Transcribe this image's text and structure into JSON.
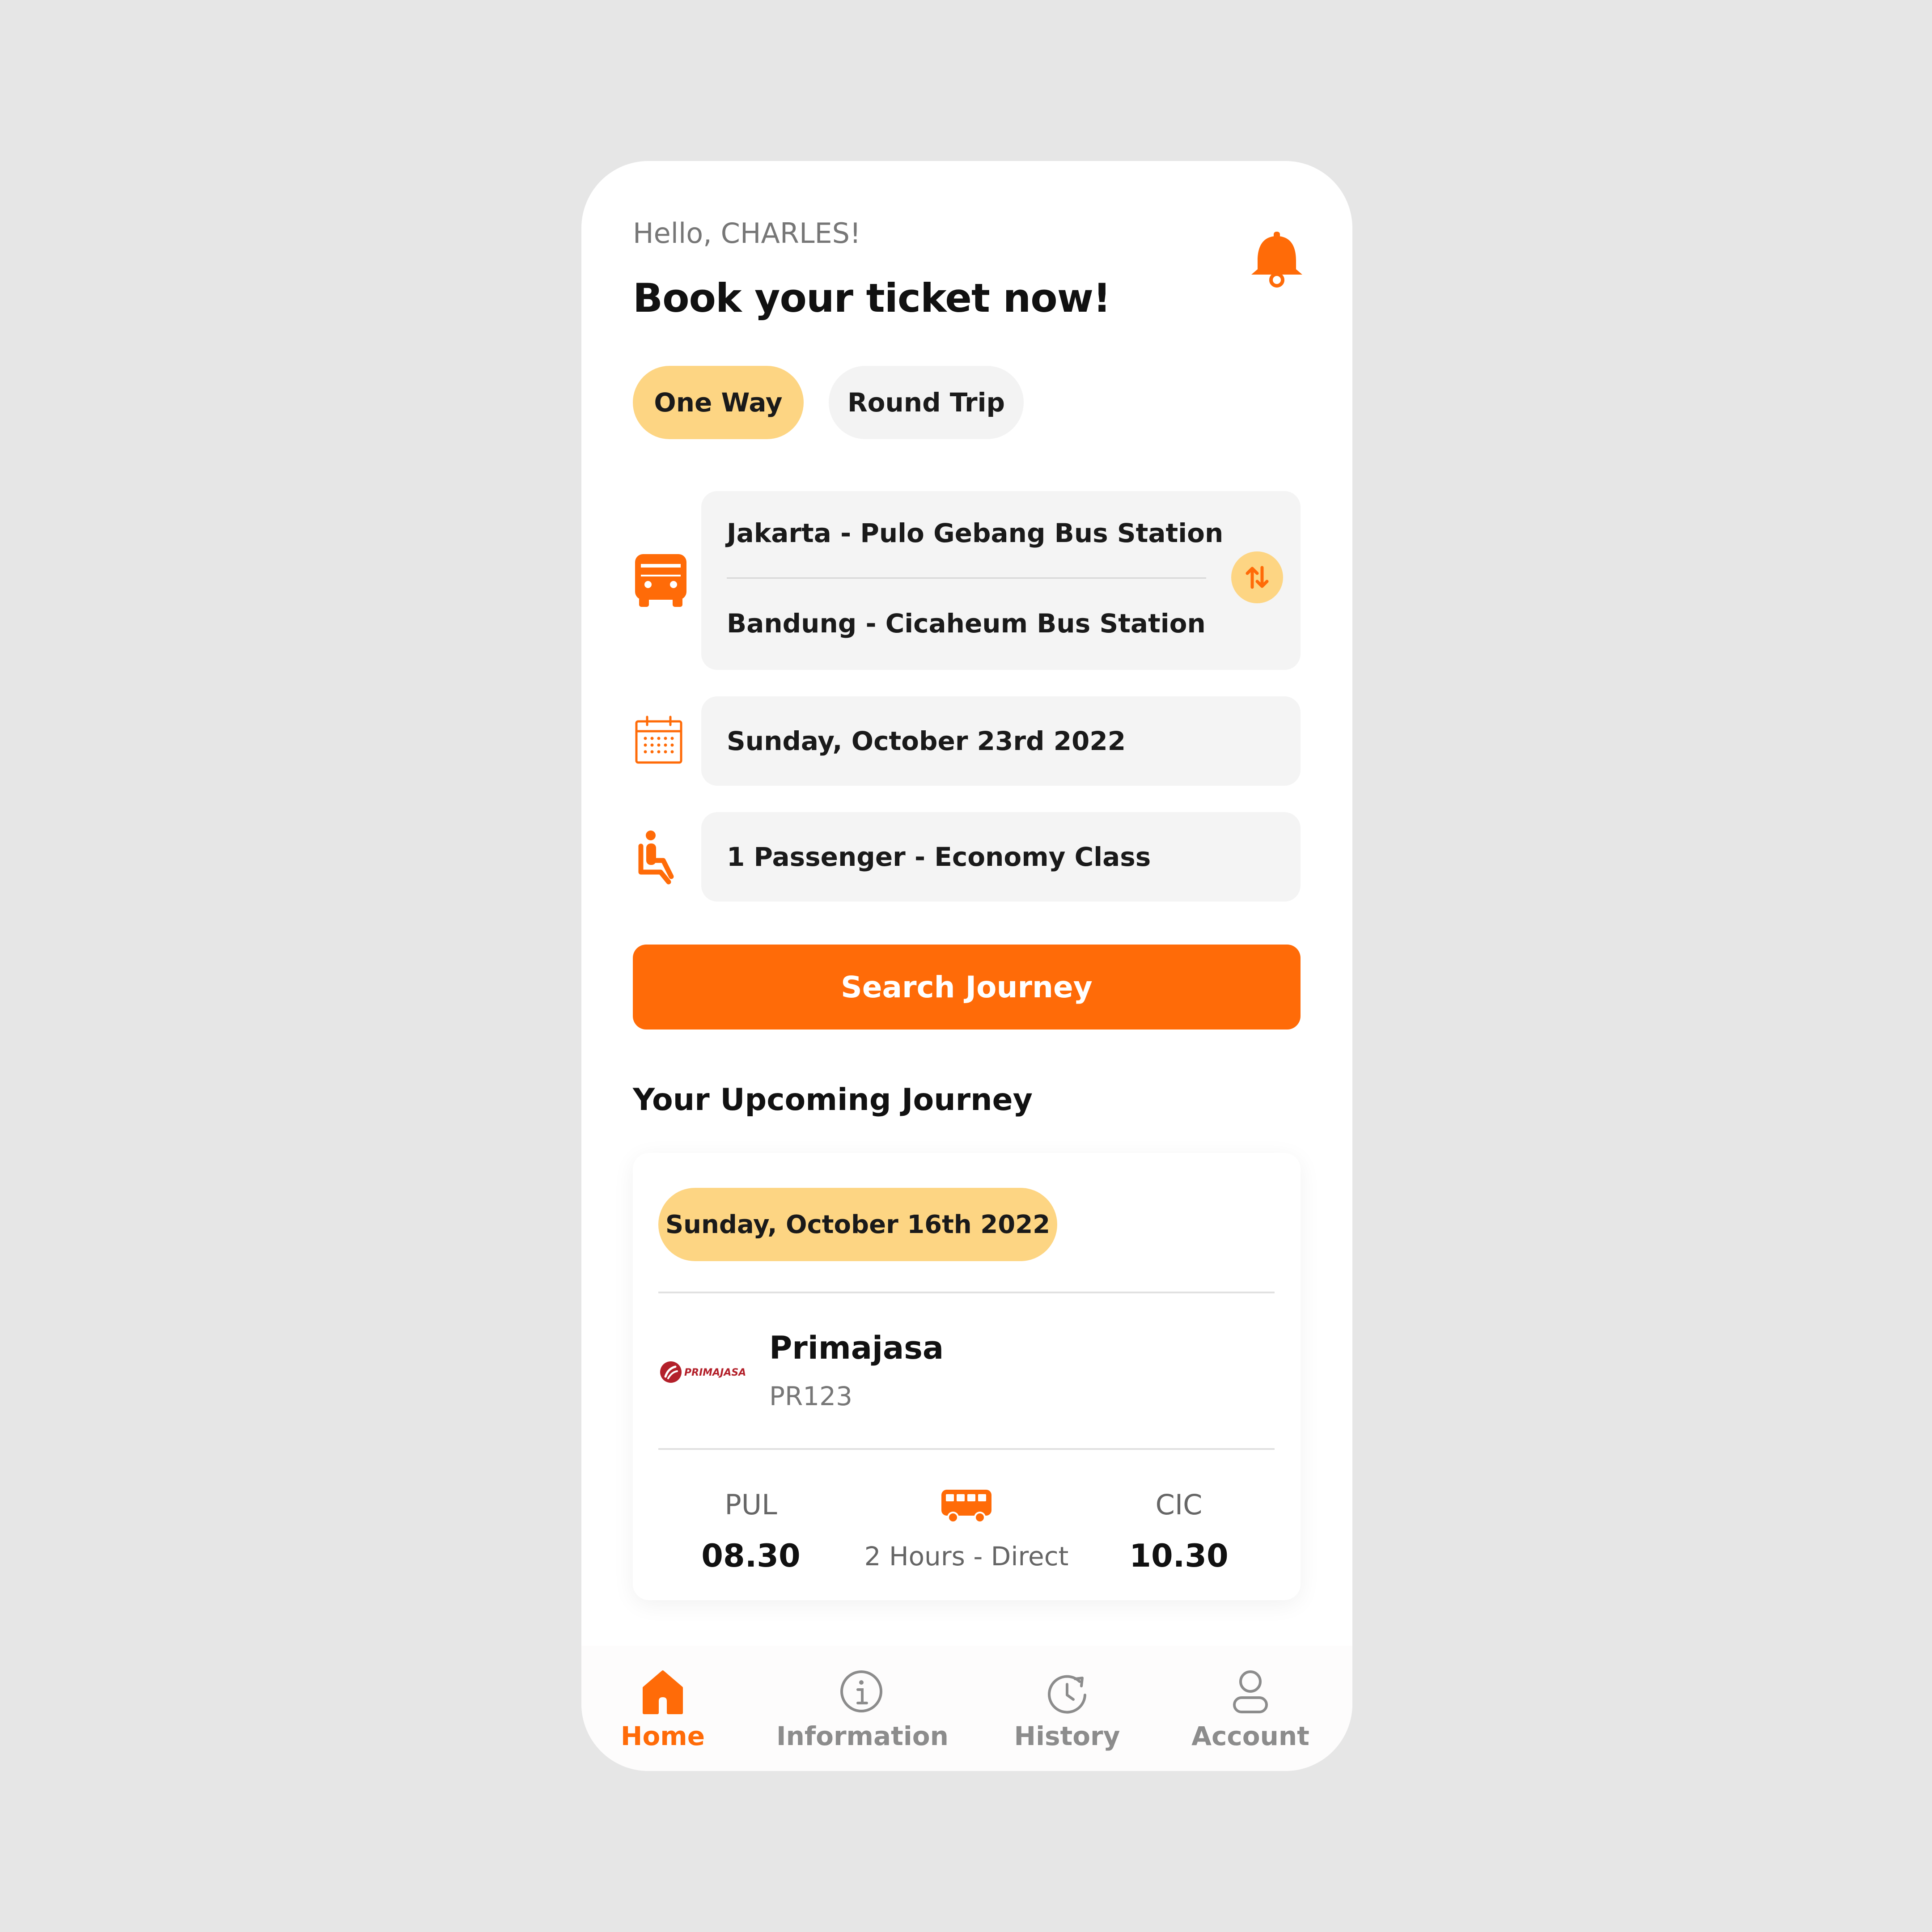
{
  "colors": {
    "accent": "#ff6b08",
    "accent_light": "#fdd583",
    "field_bg": "#f4f4f4",
    "background": "#e6e6e6",
    "logo_red": "#b3202a"
  },
  "header": {
    "greeting": "Hello, CHARLES!",
    "title": "Book your ticket now!",
    "notification_icon": "bell-icon"
  },
  "trip_type": {
    "options": [
      {
        "label": "One Way",
        "selected": true
      },
      {
        "label": "Round Trip",
        "selected": false
      }
    ]
  },
  "form": {
    "route": {
      "icon": "bus-front-icon",
      "from": "Jakarta - Pulo Gebang Bus Station",
      "to": "Bandung - Cicaheum Bus Station",
      "swap_icon": "swap-vertical-icon"
    },
    "date": {
      "icon": "calendar-icon",
      "value": "Sunday, October 23rd 2022"
    },
    "passenger": {
      "icon": "seat-icon",
      "value": "1 Passenger - Economy Class"
    },
    "search_label": "Search Journey"
  },
  "upcoming": {
    "section_title": "Your Upcoming Journey",
    "date": "Sunday, October 16th 2022",
    "operator": {
      "logo_text": "PRIMAJASA",
      "name": "Primajasa",
      "code": "PR123"
    },
    "departure": {
      "code": "PUL",
      "time": "08.30"
    },
    "arrival": {
      "code": "CIC",
      "time": "10.30"
    },
    "trip_icon": "bus-side-icon",
    "trip_info": "2 Hours - Direct"
  },
  "nav": {
    "items": [
      {
        "label": "Home",
        "icon": "home-icon",
        "active": true
      },
      {
        "label": "Information",
        "icon": "info-icon",
        "active": false
      },
      {
        "label": "History",
        "icon": "history-icon",
        "active": false
      },
      {
        "label": "Account",
        "icon": "account-icon",
        "active": false
      }
    ]
  }
}
